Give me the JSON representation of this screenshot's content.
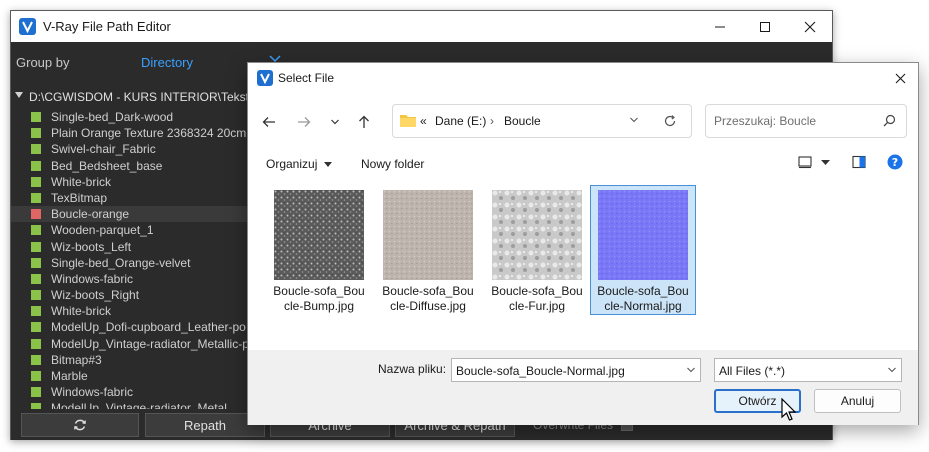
{
  "vray": {
    "title": "V-Ray File Path Editor",
    "group_by_label": "Group by",
    "group_by_value": "Directory",
    "directory": "D:\\CGWISDOM - KURS INTERIOR\\Tekstury",
    "files": [
      {
        "name": "Single-bed_Dark-wood",
        "status": "ok"
      },
      {
        "name": "Plain Orange Texture 2368324 20cm",
        "status": "ok"
      },
      {
        "name": "Swivel-chair_Fabric",
        "status": "ok"
      },
      {
        "name": "Bed_Bedsheet_base",
        "status": "ok"
      },
      {
        "name": "White-brick",
        "status": "ok"
      },
      {
        "name": "TexBitmap",
        "status": "ok"
      },
      {
        "name": "Boucle-orange",
        "status": "missing"
      },
      {
        "name": "Wooden-parquet_1",
        "status": "ok"
      },
      {
        "name": "Wiz-boots_Left",
        "status": "ok"
      },
      {
        "name": "Single-bed_Orange-velvet",
        "status": "ok"
      },
      {
        "name": "Windows-fabric",
        "status": "ok"
      },
      {
        "name": "Wiz-boots_Right",
        "status": "ok"
      },
      {
        "name": "White-brick",
        "status": "ok"
      },
      {
        "name": "ModelUp_Dofi-cupboard_Leather-po",
        "status": "ok"
      },
      {
        "name": "ModelUp_Vintage-radiator_Metallic-p",
        "status": "ok"
      },
      {
        "name": "Bitmap#3",
        "status": "ok"
      },
      {
        "name": "Marble",
        "status": "ok"
      },
      {
        "name": "Windows-fabric",
        "status": "ok"
      },
      {
        "name": "ModelUp_Vintage-radiator_Metal",
        "status": "ok"
      }
    ],
    "buttons": {
      "repath": "Repath",
      "archive": "Archive",
      "archive_repath": "Archive & Repath",
      "overwrite_files": "Overwrite Files"
    },
    "colors": {
      "ok": "#8bc34a",
      "missing": "#e06666",
      "accent": "#3aa0ff"
    }
  },
  "dialog": {
    "title": "Select File",
    "breadcrumb": {
      "root": "«",
      "drive": "Dane (E:)",
      "separator": "›",
      "folder": "Boucle"
    },
    "search_placeholder": "Przeszukaj: Boucle",
    "organize_label": "Organizuj",
    "new_folder_label": "Nowy folder",
    "files": [
      {
        "name": "Boucle-sofa_Boucle-Bump.jpg",
        "line1": "Boucle-sofa_Bou",
        "line2": "cle-Bump.jpg",
        "thumb": "bump"
      },
      {
        "name": "Boucle-sofa_Boucle-Diffuse.jpg",
        "line1": "Boucle-sofa_Bou",
        "line2": "cle-Diffuse.jpg",
        "thumb": "diffuse"
      },
      {
        "name": "Boucle-sofa_Boucle-Fur.jpg",
        "line1": "Boucle-sofa_Bou",
        "line2": "cle-Fur.jpg",
        "thumb": "fur"
      },
      {
        "name": "Boucle-sofa_Boucle-Normal.jpg",
        "line1": "Boucle-sofa_Bou",
        "line2": "cle-Normal.jpg",
        "thumb": "normal"
      }
    ],
    "filename_label": "Nazwa pliku:",
    "filename_value": "Boucle-sofa_Boucle-Normal.jpg",
    "filetype_value": "All Files (*.*)",
    "open_label": "Otwórz",
    "cancel_label": "Anuluj",
    "colors": {
      "selection": "#cce4f7",
      "primary_border": "#2a6fc9",
      "help": "#1a73e8"
    }
  }
}
